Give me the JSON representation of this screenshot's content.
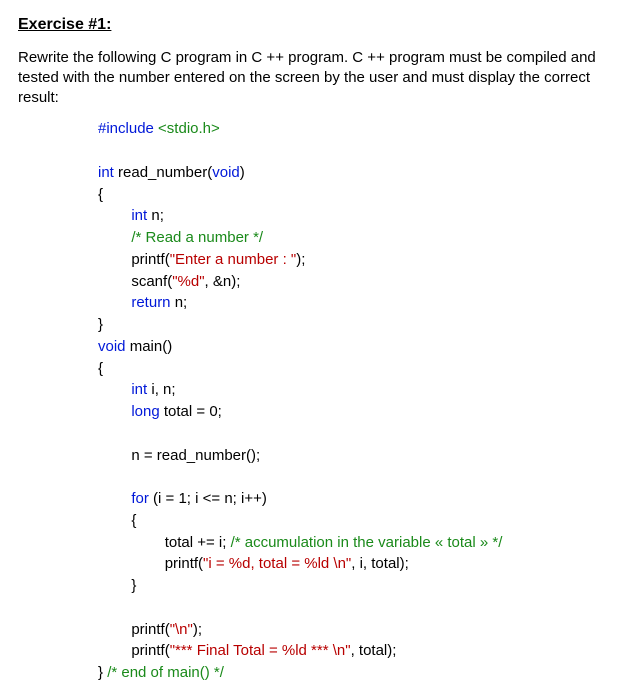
{
  "heading": "Exercise #1:",
  "intro": "Rewrite the following C program in C ++ program. C ++ program must be compiled and tested with the number entered on the screen by the user and must display the correct result:",
  "code": {
    "l01a": "#include ",
    "l01b": "<stdio.h>",
    "l02a": "int",
    "l02b": " read_number(",
    "l02c": "void",
    "l02d": ")",
    "l03": "{",
    "l04a": "int",
    "l04b": " n;",
    "l05": "/* Read a number */",
    "l06a": "printf(",
    "l06b": "\"Enter a number : \"",
    "l06c": ");",
    "l07a": "scanf(",
    "l07b": "\"%d\"",
    "l07c": ", &n);",
    "l08a": "return",
    "l08b": " n;",
    "l09": "}",
    "l10a": "void",
    "l10b": " main()",
    "l11": "{",
    "l12a": "int",
    "l12b": " i, n;",
    "l13a": "long",
    "l13b": " total = 0;",
    "l14": "n = read_number();",
    "l15a": "for",
    "l15b": " (i = 1; i <= n; i++)",
    "l16": "{",
    "l17a": "total += i; ",
    "l17b": "/* accumulation in the variable « total » */",
    "l18a": "printf(",
    "l18b": "\"i = %d, total = %ld \\n\"",
    "l18c": ", i, total);",
    "l19": "}",
    "l20a": "printf(",
    "l20b": "\"\\n\"",
    "l20c": ");",
    "l21a": "printf(",
    "l21b": "\"*** Final Total = %ld *** \\n\"",
    "l21c": ", total);",
    "l22a": "} ",
    "l22b": "/* end of main() */"
  }
}
